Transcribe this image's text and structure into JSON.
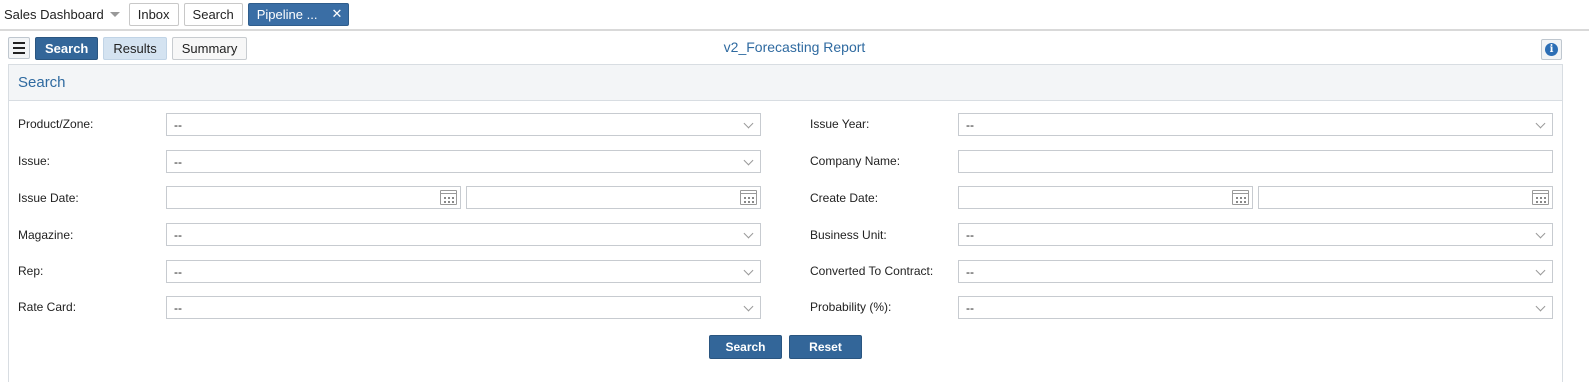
{
  "tabs": {
    "dashboard_label": "Sales Dashboard",
    "inbox_label": "Inbox",
    "search_label": "Search",
    "pipeline_label": "Pipeline ...",
    "close_glyph": "✕"
  },
  "toolbar": {
    "search_label": "Search",
    "results_label": "Results",
    "summary_label": "Summary",
    "info_glyph": "i"
  },
  "report_title": "v2_Forecasting Report",
  "panel": {
    "title": "Search"
  },
  "form": {
    "product_zone": {
      "label": "Product/Zone:",
      "value": "--"
    },
    "issue": {
      "label": "Issue:",
      "value": "--"
    },
    "issue_date": {
      "label": "Issue Date:",
      "from": "",
      "to": ""
    },
    "magazine": {
      "label": "Magazine:",
      "value": "--"
    },
    "rep": {
      "label": "Rep:",
      "value": "--"
    },
    "rate_card": {
      "label": "Rate Card:",
      "value": "--"
    },
    "issue_year": {
      "label": "Issue Year:",
      "value": "--"
    },
    "company_name": {
      "label": "Company Name:",
      "value": ""
    },
    "create_date": {
      "label": "Create Date:",
      "from": "",
      "to": ""
    },
    "business_unit": {
      "label": "Business Unit:",
      "value": "--"
    },
    "converted_to_contract": {
      "label": "Converted To Contract:",
      "value": "--"
    },
    "probability": {
      "label": "Probability (%):",
      "value": "--"
    }
  },
  "actions": {
    "search_label": "Search",
    "reset_label": "Reset"
  },
  "colors": {
    "primary": "#336699",
    "title_text": "#2f6aa0",
    "light_tab": "#d4e3f1"
  },
  "icons": [
    "chevron-down-icon",
    "close-icon",
    "menu-icon",
    "info-icon",
    "calendar-icon"
  ]
}
